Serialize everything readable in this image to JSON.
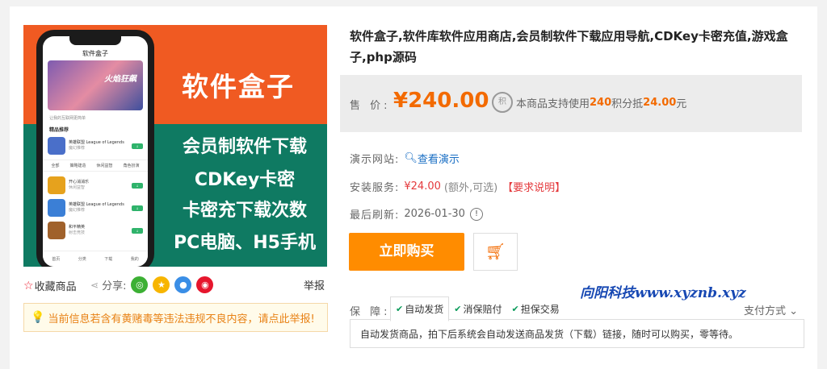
{
  "banner": {
    "title": "软件盒子",
    "lines": [
      "会员制软件下载",
      "CDKey卡密",
      "卡密充下载次数",
      "PC电脑、H5手机"
    ],
    "phone": {
      "header": "软件盒子",
      "hero_text": "火焰狂飙",
      "notice": "让我的互联网更简单",
      "section": "精品推荐",
      "apps": [
        {
          "name": "英雄联盟 League of Legends",
          "sub": "魔幻推荐"
        },
        {
          "name": "开心消消乐",
          "sub": "休闲益智"
        },
        {
          "name": "英雄联盟 League of Legends",
          "sub": "魔幻推荐"
        },
        {
          "name": "和平精英",
          "sub": "射击竞技"
        }
      ],
      "tabs": [
        "全部",
        "策略建造",
        "休闲益智",
        "角色扮演",
        "动作冒险"
      ],
      "nav": [
        "首页",
        "分类",
        "下载",
        "我的"
      ]
    }
  },
  "left": {
    "favorite_label": "收藏商品",
    "share_label": "分享:",
    "report_label": "举报",
    "warning": "当前信息若含有黄赌毒等违法违规不良内容，请点此举报!"
  },
  "product": {
    "title": "软件盒子,软件库软件应用商店,会员制软件下载应用导航,CDKey卡密充值,游戏盒子,php源码",
    "price_label": "售 价:",
    "price": "¥240.00",
    "points_icon": "积",
    "points_prefix": "本商品支持使用",
    "points_value": "240",
    "points_mid": "积分抵",
    "points_amount": "24.00",
    "points_suffix": "元",
    "demo_label": "演示网站:",
    "demo_link": "查看演示",
    "install_label": "安装服务:",
    "install_price": "¥24.00",
    "install_note": "(额外,可选)",
    "install_req": "【要求说明】",
    "refresh_label": "最后刷新:",
    "refresh_date": "2026-01-30",
    "buy_label": "立即购买",
    "watermark": "向阳科技www.xyznb.xyz",
    "guard_label": "保 障:",
    "guard_tags": [
      "自动发货",
      "消保赔付",
      "担保交易"
    ],
    "pay_label": "支付方式",
    "guard_desc": "自动发货商品，拍下后系统会自动发送商品发货（下载）链接，随时可以购买，零等待。"
  },
  "colors": {
    "accent": "#f36a00",
    "buy": "#ff8c00",
    "banner_orange": "#f05a22",
    "banner_green": "#0f7a62"
  }
}
